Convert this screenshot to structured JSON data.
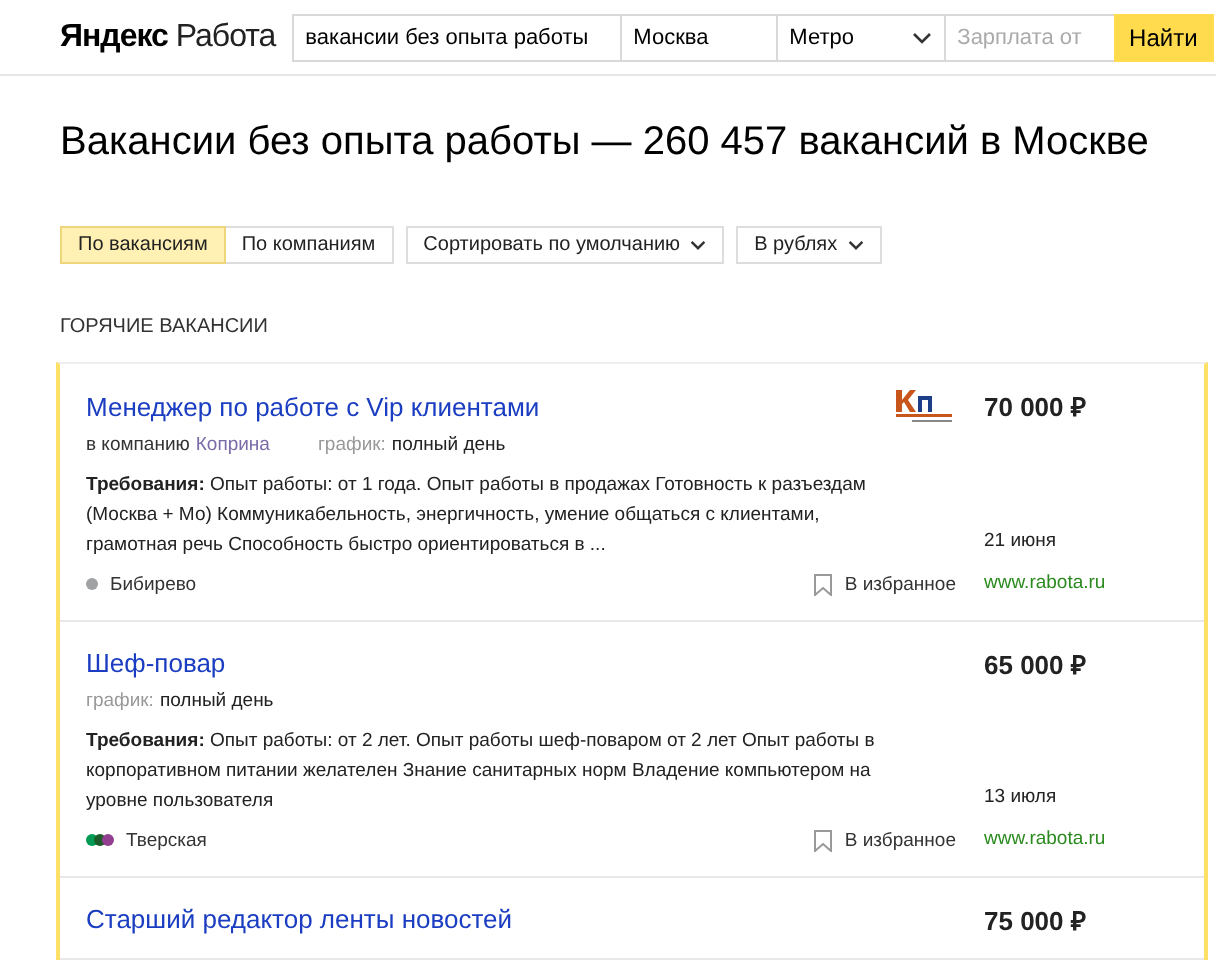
{
  "header": {
    "logo": {
      "brand": "Яндекс",
      "service": "Работа"
    },
    "search": {
      "query": "вакансии без опыта работы",
      "city": "Москва",
      "metro": "Метро",
      "salary_placeholder": "Зарплата от",
      "button": "Найти"
    }
  },
  "heading": "Вакансии без опыта работы — 260 457 вакансий в Москве",
  "tabs": [
    {
      "label": "По вакансиям",
      "selected": true
    },
    {
      "label": "По компаниям",
      "selected": false
    }
  ],
  "dropdowns": [
    "Сортировать по умолчанию",
    "В рублях"
  ],
  "section_title": "ГОРЯЧИЕ ВАКАНСИИ",
  "vacancies": [
    {
      "title": "Менеджер по работе с Vip клиентами",
      "salary": "70 000 ₽",
      "logo": true,
      "company_prefix": "в компанию",
      "company": "Коприна",
      "schedule_label": "график:",
      "schedule": "полный день",
      "requirements": "**Требования:** Опыт работы: от 1 года. Опыт работы в продажах Готовность к разъездам (Москва + Мо) Коммуникабельность, энергичность, умение общаться с клиентами, грамотная речь Способность быстро ориентироваться в ...",
      "date": "21 июня",
      "metro": {
        "name": "Бибирево",
        "lines": [
          {
            "color": "#a0a2a3"
          }
        ]
      },
      "favorite": "В избранное",
      "source": "www.rabota.ru"
    },
    {
      "title": "Шеф-повар",
      "salary": "65 000 ₽",
      "logo": false,
      "schedule_label": "график:",
      "schedule": "полный день",
      "requirements": "**Требования:** Опыт работы: от 2 лет. Опыт работы шеф-поваром от 2 лет Опыт работы в корпоративном питании желателен Знание санитарных норм Владение компьютером на уровне пользователя",
      "date": "13 июля",
      "metro": {
        "name": "Тверская",
        "lines": [
          {
            "color": "#029a55"
          },
          {
            "color": "#1e5b2a"
          },
          {
            "color": "#943e90"
          }
        ]
      },
      "favorite": "В избранное",
      "source": "www.rabota.ru"
    },
    {
      "title": "Старший редактор ленты новостей",
      "salary": "75 000 ₽",
      "logo": false
    }
  ]
}
